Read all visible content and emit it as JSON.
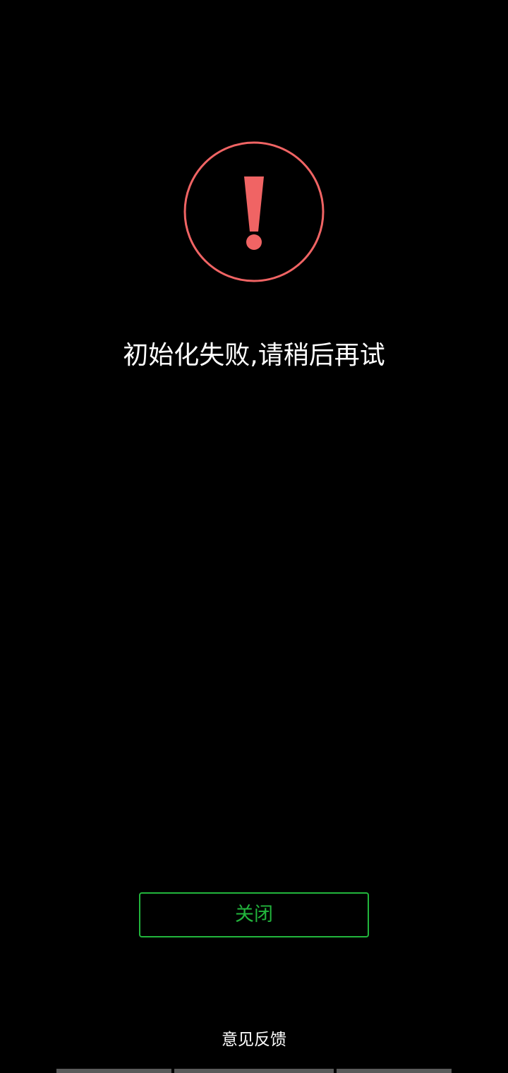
{
  "error": {
    "icon": "exclamation-icon",
    "icon_color": "#f06464",
    "message": "初始化失败,请稍后再试"
  },
  "actions": {
    "close_label": "关闭",
    "close_color": "#22b53c"
  },
  "footer": {
    "feedback_label": "意见反馈"
  }
}
